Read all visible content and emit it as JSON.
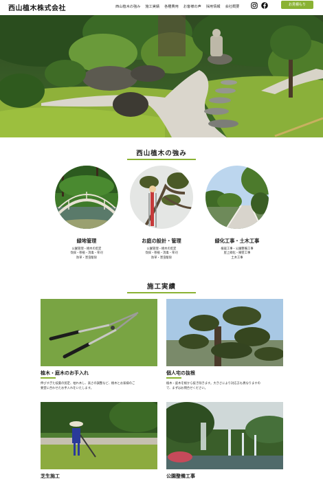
{
  "header": {
    "logo": "西山植木株式会社",
    "nav": [
      "西山植木の強み",
      "施工実績",
      "各種費用",
      "お客様の声",
      "採用情報",
      "会社概要"
    ],
    "social_icons": [
      "instagram-icon",
      "facebook-icon"
    ],
    "contact_label": "お見積もり"
  },
  "strengths": {
    "title": "西山植木の強み",
    "items": [
      {
        "title": "緑地管理",
        "lines": [
          "公園管理・樹木の剪定",
          "伐採・移植・消毒・草刈",
          "防草・害虫駆除"
        ]
      },
      {
        "title": "お庭の設計・管理",
        "lines": [
          "公園管理・樹木の剪定",
          "伐採・移植・消毒・草刈",
          "防草・害虫駆除"
        ]
      },
      {
        "title": "緑化工事・土木工事",
        "lines": [
          "植栽工事・公園整備工事",
          "屋上緑化・擁壁工事",
          "土木工事"
        ]
      }
    ]
  },
  "works": {
    "title": "施工実績",
    "items": [
      {
        "title": "植木・庭木のお手入れ",
        "lines": [
          "伸びすぎた枝葉の剪定、枯れ木し、高さの調整など、樹木とお家様のご",
          "要望に合わせたお手入れをいたします。"
        ]
      },
      {
        "title": "個人宅の抜根",
        "lines": [
          "植木・庭木を根から抜き除きます。大きさにより対応方も異なりますの",
          "で、まずはお問合せください。"
        ]
      },
      {
        "title": "芝生施工",
        "lines": []
      },
      {
        "title": "公園整備工事",
        "lines": []
      }
    ]
  },
  "colors": {
    "accent": "#8ab233",
    "text": "#222222"
  }
}
